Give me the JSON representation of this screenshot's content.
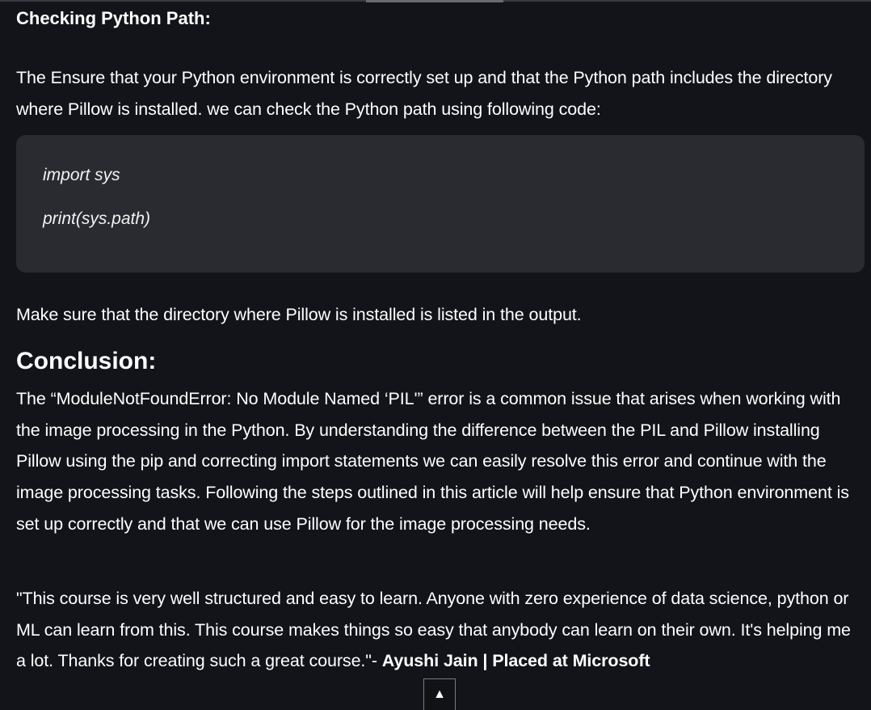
{
  "article": {
    "python_path_heading": "Checking Python Path:",
    "python_path_paragraph": "The Ensure that your Python environment is correctly set up and that the Python path includes the directory where Pillow is installed. we can check the Python path using following code:",
    "code_lines": [
      "import sys",
      "print(sys.path)"
    ],
    "after_code_paragraph": "Make sure that the directory where Pillow is installed is listed in the output.",
    "conclusion_heading": "Conclusion:",
    "conclusion_paragraph": "The “ModuleNotFoundError: No Module Named ‘PIL'” error is a common issue that arises when working with the image processing in the Python. By understanding the difference between the PIL and Pillow installing Pillow using the pip and correcting import statements we can easily resolve this error and continue with the image processing tasks. Following the steps outlined in this article will help ensure that Python environment is set up correctly and that we can use Pillow for the image processing needs."
  },
  "testimonial": {
    "quote": "\"This course is very well structured and easy to learn. Anyone with zero experience of data science, python or ML can learn from this. This course makes things so easy that anybody can learn on their own. It's helping me a lot. Thanks for creating such a great course.\"- ",
    "author": "Ayushi Jain | Placed at Microsoft"
  },
  "scroll_top_button": {
    "icon": "arrow-up-icon",
    "glyph": "▲"
  }
}
